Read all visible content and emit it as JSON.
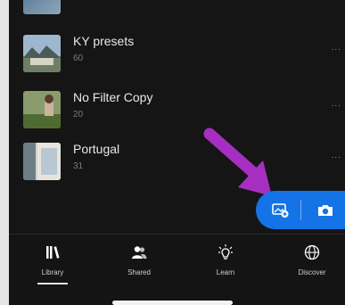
{
  "albums": [
    {
      "title": "KY presets",
      "count": "60"
    },
    {
      "title": "No Filter Copy",
      "count": "20"
    },
    {
      "title": "Portugal",
      "count": "31"
    }
  ],
  "more_label": "...",
  "fab": {
    "add_photos_icon": "add-photos-icon",
    "camera_icon": "camera-icon"
  },
  "nav": [
    {
      "label": "Library",
      "icon": "library-icon",
      "active": true
    },
    {
      "label": "Shared",
      "icon": "shared-people-icon",
      "active": false
    },
    {
      "label": "Learn",
      "icon": "learn-bulb-icon",
      "active": false
    },
    {
      "label": "Discover",
      "icon": "discover-globe-icon",
      "active": false
    }
  ],
  "colors": {
    "accent": "#1473e6",
    "annotation_arrow": "#a62fc1",
    "background": "#151515"
  }
}
